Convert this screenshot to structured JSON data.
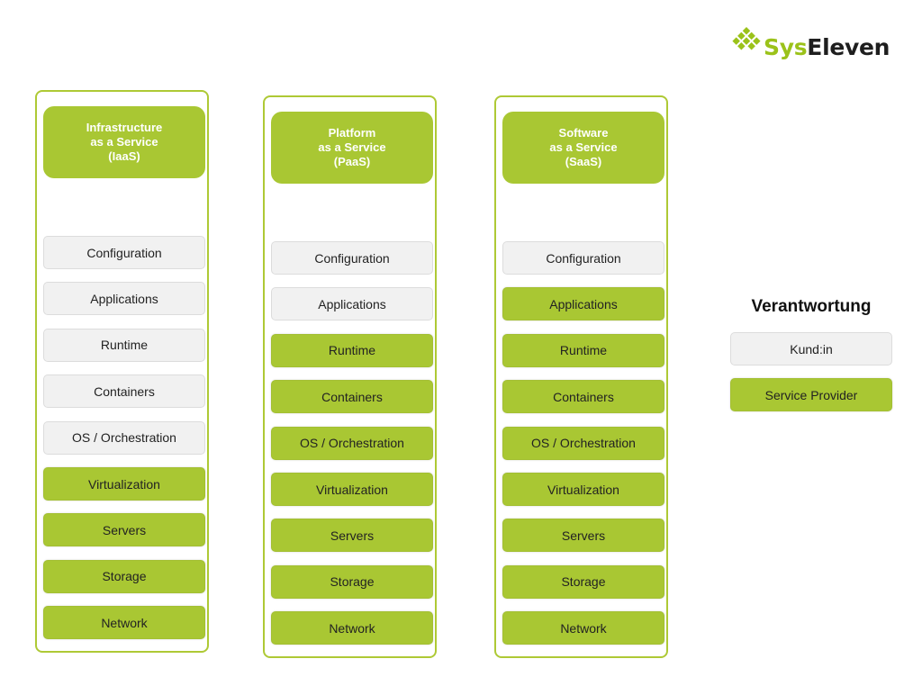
{
  "logo": {
    "part1": "Sys",
    "part2": "Eleven",
    "icon": "diamond-grid-icon",
    "colors": {
      "green": "#9bc21a",
      "dark": "#1e1e1e"
    }
  },
  "colors": {
    "provider": "#a9c733",
    "customer": "#f1f1f1",
    "border": "#aec935"
  },
  "columns": [
    {
      "title_lines": [
        "Infrastructure",
        "as a Service",
        "(IaaS)"
      ],
      "items": [
        {
          "label": "Configuration",
          "owner": "customer"
        },
        {
          "label": "Applications",
          "owner": "customer"
        },
        {
          "label": "Runtime",
          "owner": "customer"
        },
        {
          "label": "Containers",
          "owner": "customer"
        },
        {
          "label": "OS / Orchestration",
          "owner": "customer"
        },
        {
          "label": "Virtualization",
          "owner": "provider"
        },
        {
          "label": "Servers",
          "owner": "provider"
        },
        {
          "label": "Storage",
          "owner": "provider"
        },
        {
          "label": "Network",
          "owner": "provider"
        }
      ]
    },
    {
      "title_lines": [
        "Platform",
        "as a Service",
        "(PaaS)"
      ],
      "items": [
        {
          "label": "Configuration",
          "owner": "customer"
        },
        {
          "label": "Applications",
          "owner": "customer"
        },
        {
          "label": "Runtime",
          "owner": "provider"
        },
        {
          "label": "Containers",
          "owner": "provider"
        },
        {
          "label": "OS / Orchestration",
          "owner": "provider"
        },
        {
          "label": "Virtualization",
          "owner": "provider"
        },
        {
          "label": "Servers",
          "owner": "provider"
        },
        {
          "label": "Storage",
          "owner": "provider"
        },
        {
          "label": "Network",
          "owner": "provider"
        }
      ]
    },
    {
      "title_lines": [
        "Software",
        "as a Service",
        "(SaaS)"
      ],
      "items": [
        {
          "label": "Configuration",
          "owner": "customer"
        },
        {
          "label": "Applications",
          "owner": "provider"
        },
        {
          "label": "Runtime",
          "owner": "provider"
        },
        {
          "label": "Containers",
          "owner": "provider"
        },
        {
          "label": "OS / Orchestration",
          "owner": "provider"
        },
        {
          "label": "Virtualization",
          "owner": "provider"
        },
        {
          "label": "Servers",
          "owner": "provider"
        },
        {
          "label": "Storage",
          "owner": "provider"
        },
        {
          "label": "Network",
          "owner": "provider"
        }
      ]
    }
  ],
  "legend": {
    "title": "Verantwortung",
    "items": [
      {
        "label": "Kund:in",
        "owner": "customer"
      },
      {
        "label": "Service Provider",
        "owner": "provider"
      }
    ]
  }
}
